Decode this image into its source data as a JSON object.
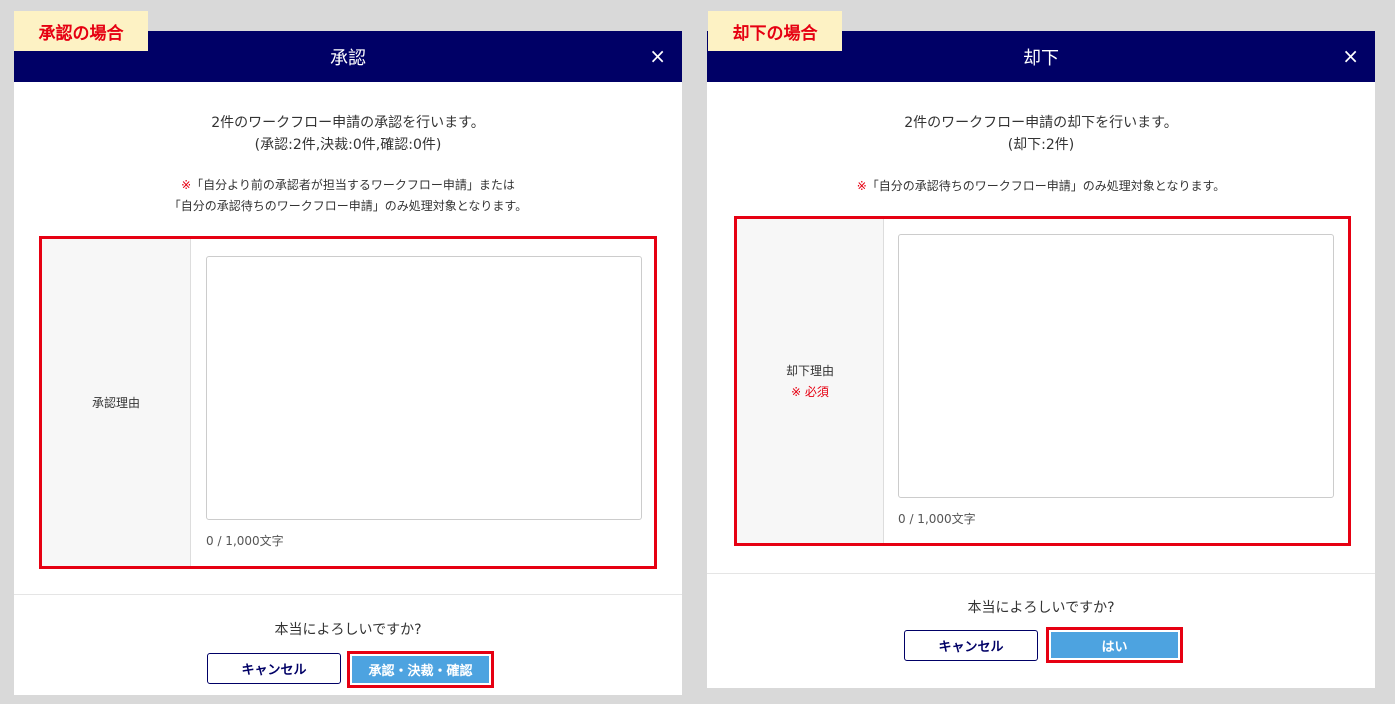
{
  "approve": {
    "case_label": "承認の場合",
    "title": "承認",
    "close_glyph": "×",
    "message_line1": "2件のワークフロー申請の承認を行います。",
    "message_line2": "(承認:2件,決裁:0件,確認:0件)",
    "note_mark": "※",
    "note_line1": "「自分より前の承認者が担当するワークフロー申請」または",
    "note_line2": "「自分の承認待ちのワークフロー申請」のみ処理対象となります。",
    "field_label": "承認理由",
    "textarea_value": "",
    "counter": "0 / 1,000文字",
    "confirm": "本当によろしいですか?",
    "cancel_label": "キャンセル",
    "ok_label": "承認・決裁・確認"
  },
  "reject": {
    "case_label": "却下の場合",
    "title": "却下",
    "close_glyph": "×",
    "message_line1": "2件のワークフロー申請の却下を行います。",
    "message_line2": "(却下:2件)",
    "note_mark": "※",
    "note_line1": "「自分の承認待ちのワークフロー申請」のみ処理対象となります。",
    "field_label": "却下理由",
    "required": "※ 必須",
    "textarea_value": "",
    "counter": "0 / 1,000文字",
    "confirm": "本当によろしいですか?",
    "cancel_label": "キャンセル",
    "ok_label": "はい"
  },
  "colors": {
    "header": "#000066",
    "highlight": "#e60012",
    "primary_button": "#4da3e0",
    "label_bg": "#fdf2c4"
  },
  "icons": {
    "close": "close-icon"
  }
}
